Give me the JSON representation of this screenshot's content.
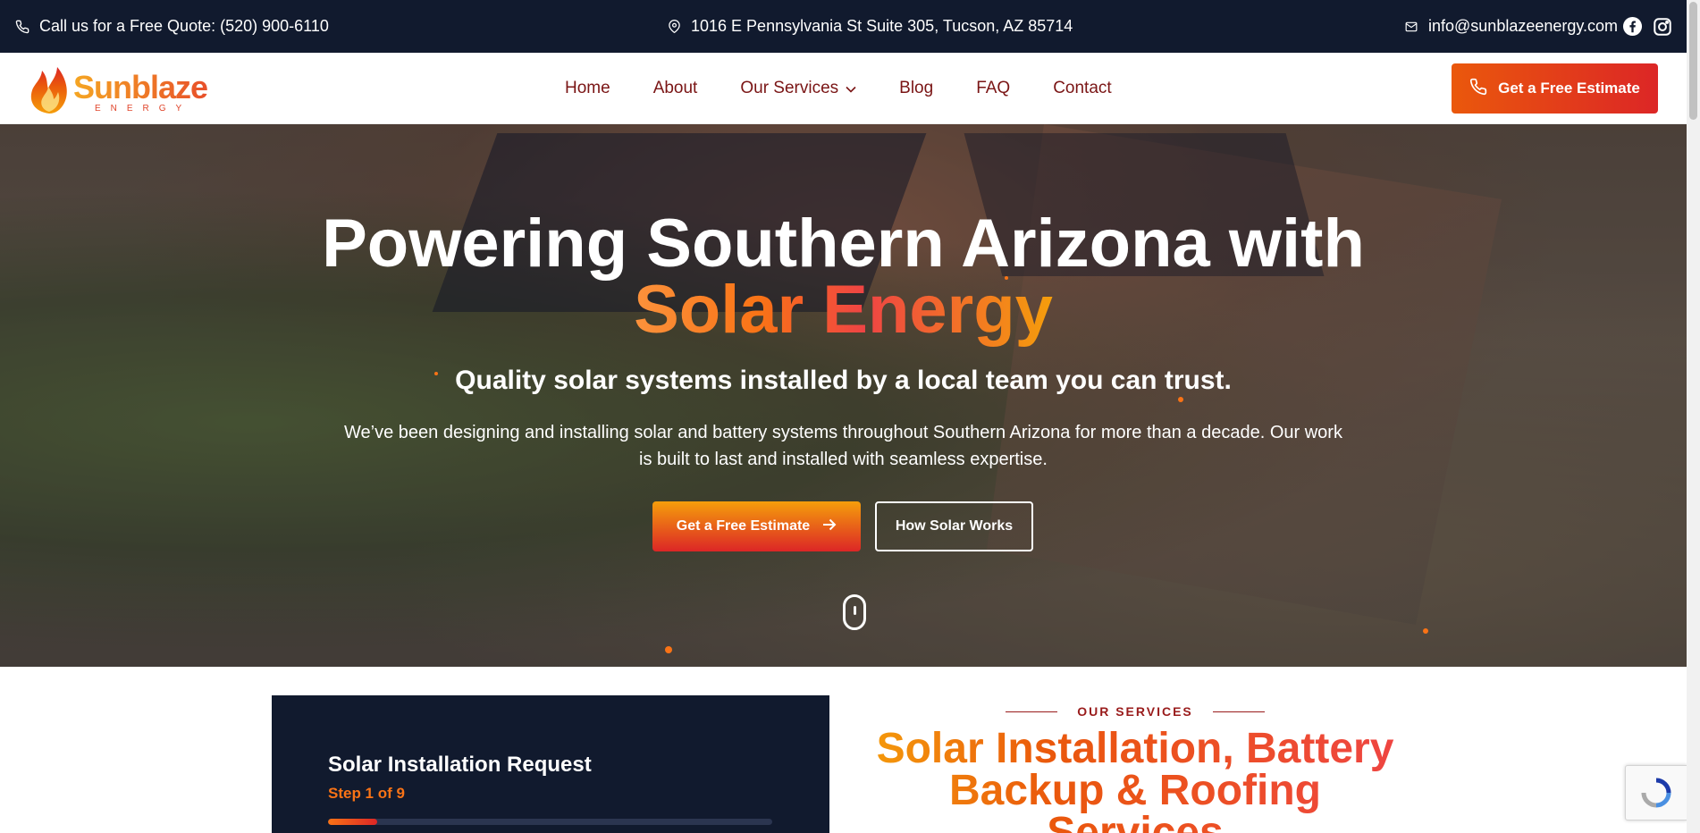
{
  "topbar": {
    "phone_text": "Call us for a Free Quote: (520) 900-6110",
    "address": "1016 E Pennsylvania St Suite 305, Tucson, AZ 85714",
    "email": "info@sunblazeenergy.com",
    "icons": [
      "phone-icon",
      "map-pin-icon",
      "mail-icon",
      "facebook-icon",
      "instagram-icon"
    ]
  },
  "header": {
    "logo_name": "Sunblaze",
    "logo_sub": "ENERGY",
    "nav": [
      {
        "label": "Home"
      },
      {
        "label": "About"
      },
      {
        "label": "Our Services"
      },
      {
        "label": "Blog"
      },
      {
        "label": "FAQ"
      },
      {
        "label": "Contact"
      }
    ],
    "cta_label": "Get a Free Estimate"
  },
  "hero": {
    "title_line1": "Powering Southern Arizona with",
    "title_line2": "Solar Energy",
    "subtitle": "Quality solar systems installed by a local team you can trust.",
    "description": "We’ve been designing and installing solar and battery systems throughout Southern Arizona for more than a decade. Our work is built to last and installed with seamless expertise.",
    "primary_button": "Get a Free Estimate",
    "secondary_button": "How Solar Works"
  },
  "form": {
    "title": "Solar Installation Request",
    "step": "Step 1 of 9",
    "progress": 0.11
  },
  "services": {
    "eyebrow": "OUR SERVICES",
    "title": "Solar Installation, Battery Backup & Roofing Services"
  },
  "colors": {
    "dark_navy": "#111a2e",
    "accent_orange": "#ea580c",
    "accent_red": "#dc2626",
    "nav_text": "#7a1515"
  }
}
